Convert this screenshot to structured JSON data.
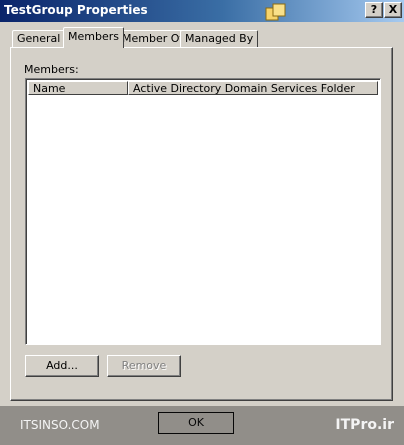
{
  "window": {
    "title": "TestGroup Properties",
    "help_label": "?",
    "close_label": "X"
  },
  "tabs": [
    {
      "label": "General",
      "active": false
    },
    {
      "label": "Members",
      "active": true
    },
    {
      "label": "Member Of",
      "active": false
    },
    {
      "label": "Managed By",
      "active": false
    }
  ],
  "members": {
    "label": "Members:",
    "columns": [
      "Name",
      "Active Directory Domain Services Folder"
    ],
    "rows": []
  },
  "buttons": {
    "add": "Add...",
    "remove": "Remove",
    "ok": "OK"
  },
  "watermark": {
    "left": "ITSINSO.COM",
    "right": "ITPro.ir"
  }
}
